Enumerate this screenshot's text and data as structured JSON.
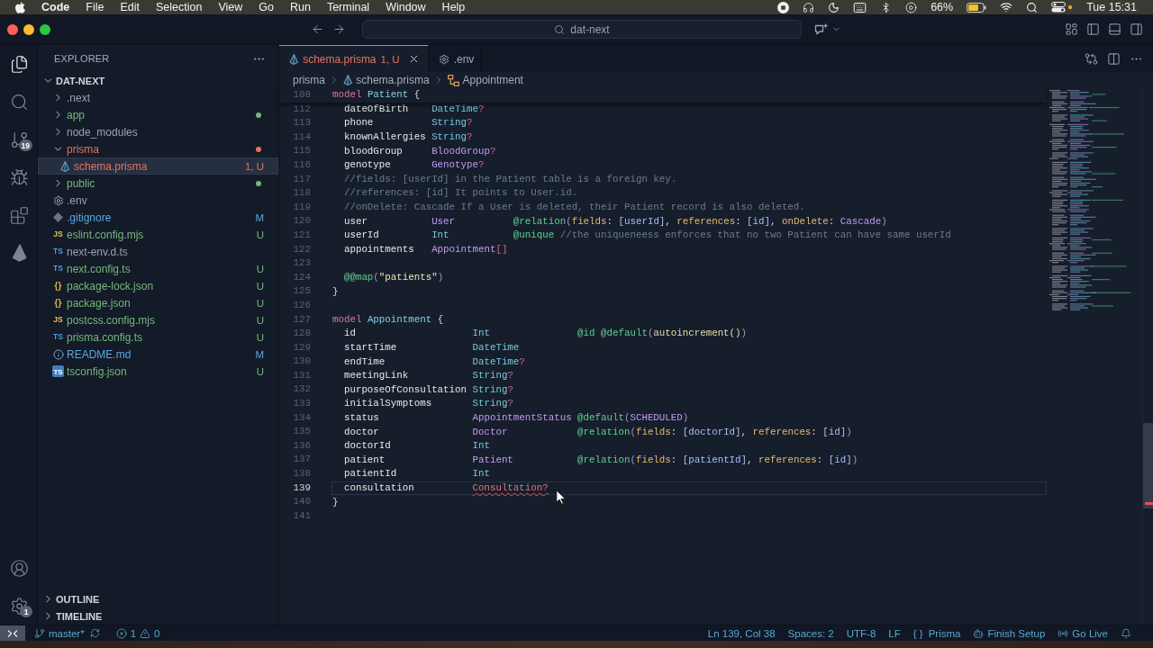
{
  "menu_bar": {
    "app": "Code",
    "menus": [
      "File",
      "Edit",
      "Selection",
      "View",
      "Go",
      "Run",
      "Terminal",
      "Window",
      "Help"
    ],
    "battery": "66%",
    "clock": "Tue 15:31"
  },
  "title_bar": {
    "search": "dat-next"
  },
  "activity_bar": {
    "items": [
      {
        "kind": "files",
        "selected": true
      },
      {
        "kind": "search",
        "selected": false
      },
      {
        "kind": "source-control",
        "selected": false,
        "badge": "19"
      },
      {
        "kind": "run",
        "selected": false
      },
      {
        "kind": "extensions",
        "selected": false
      },
      {
        "kind": "prisma",
        "selected": false
      }
    ],
    "bottom": [
      {
        "kind": "accounts"
      },
      {
        "kind": "settings",
        "badge": "1"
      }
    ]
  },
  "explorer": {
    "title": "EXPLORER",
    "root": {
      "label": "DAT-NEXT",
      "expanded": true
    },
    "items": [
      {
        "name": ".next",
        "kind": "folder",
        "expanded": false,
        "color": "#9aa2af",
        "selected": false
      },
      {
        "name": "app",
        "kind": "folder",
        "expanded": false,
        "color": "#74b87a",
        "dot": true,
        "selected": false
      },
      {
        "name": "node_modules",
        "kind": "folder",
        "expanded": false,
        "color": "#9aa2af",
        "selected": false
      },
      {
        "name": "prisma",
        "kind": "folder",
        "expanded": true,
        "color": "#e3735f",
        "dot": true,
        "selected": false,
        "children": [
          {
            "name": "schema.prisma",
            "kind": "prisma",
            "color": "#e3735f",
            "decoration": "1, U",
            "selected": true
          }
        ]
      },
      {
        "name": "public",
        "kind": "folder",
        "expanded": false,
        "color": "#74b87a",
        "dot": true,
        "selected": false
      },
      {
        "name": ".env",
        "kind": "env",
        "color": "#9aa2af",
        "selected": false
      },
      {
        "name": ".gitignore",
        "kind": "git",
        "color": "#5aa7dc",
        "decoration": "M",
        "selected": false
      },
      {
        "name": "eslint.config.mjs",
        "kind": "js",
        "badge": "JS",
        "color": "#74b87a",
        "decoration": "U",
        "selected": false
      },
      {
        "name": "next-env.d.ts",
        "kind": "ts",
        "badge": "TS",
        "color": "#9aa2af",
        "selected": false
      },
      {
        "name": "next.config.ts",
        "kind": "ts",
        "badge": "TS",
        "color": "#74b87a",
        "decoration": "U",
        "selected": false
      },
      {
        "name": "package-lock.json",
        "kind": "json",
        "badge": "{}",
        "color": "#74b87a",
        "decoration": "U",
        "selected": false
      },
      {
        "name": "package.json",
        "kind": "json",
        "badge": "{}",
        "color": "#74b87a",
        "decoration": "U",
        "selected": false
      },
      {
        "name": "postcss.config.mjs",
        "kind": "js",
        "badge": "JS",
        "color": "#74b87a",
        "decoration": "U",
        "selected": false
      },
      {
        "name": "prisma.config.ts",
        "kind": "ts",
        "badge": "TS",
        "color": "#74b87a",
        "decoration": "U",
        "selected": false
      },
      {
        "name": "README.md",
        "kind": "markdown",
        "color": "#5aa7dc",
        "decoration": "M",
        "selected": false
      },
      {
        "name": "tsconfig.json",
        "kind": "tsconfig",
        "badge": "TS",
        "color": "#74b87a",
        "decoration": "U",
        "selected": false
      }
    ],
    "sections": [
      {
        "label": "OUTLINE",
        "expanded": false
      },
      {
        "label": "TIMELINE",
        "expanded": false
      }
    ]
  },
  "tabs": [
    {
      "label": "schema.prisma",
      "kind": "prisma",
      "color": "#e3735f",
      "decoration": "1, U",
      "selected": true
    },
    {
      "label": ".env",
      "kind": "env",
      "color": "#a0a8b5",
      "selected": false
    }
  ],
  "breadcrumbs": [
    {
      "label": "prisma",
      "kind": "folder"
    },
    {
      "label": "schema.prisma",
      "kind": "prisma"
    },
    {
      "label": "Appointment",
      "kind": "model"
    }
  ],
  "editor": {
    "sticky_line": {
      "number": "108",
      "keyword": "model",
      "name": "Patient",
      "brace": "{"
    },
    "lines": [
      {
        "number": "112",
        "kind": "field",
        "current": false,
        "name": "dateOfBirth",
        "type": {
          "kind": "scalar",
          "name": "DateTime",
          "modifier": "?"
        }
      },
      {
        "number": "113",
        "kind": "field",
        "current": false,
        "name": "phone",
        "type": {
          "kind": "scalar",
          "name": "String",
          "modifier": "?"
        }
      },
      {
        "number": "114",
        "kind": "field",
        "current": false,
        "name": "knownAllergies",
        "type": {
          "kind": "scalar",
          "name": "String",
          "modifier": "?"
        }
      },
      {
        "number": "115",
        "kind": "field",
        "current": false,
        "name": "bloodGroup",
        "type": {
          "kind": "ref",
          "name": "BloodGroup",
          "modifier": "?"
        }
      },
      {
        "number": "116",
        "kind": "field",
        "current": false,
        "name": "genotype",
        "type": {
          "kind": "ref",
          "name": "Genotype",
          "modifier": "?"
        }
      },
      {
        "number": "117",
        "kind": "comment",
        "current": false,
        "text": "//fields: [userId] in the Patient table is a foreign key."
      },
      {
        "number": "118",
        "kind": "comment",
        "current": false,
        "text": "//references: [id] It points to User.id."
      },
      {
        "number": "119",
        "kind": "comment",
        "current": false,
        "text": "//onDelete: Cascade If a User is deleted, their Patient record is also deleted."
      },
      {
        "number": "120",
        "kind": "field",
        "current": false,
        "name": "user",
        "type": {
          "kind": "ref",
          "name": "User"
        },
        "attributes": [
          {
            "tokens": [
              {
                "kind": "attr",
                "text": "@relation"
              },
              {
                "kind": "paren",
                "text": "("
              },
              {
                "kind": "arg",
                "text": "fields"
              },
              {
                "kind": "plain",
                "text": ": "
              },
              {
                "kind": "list",
                "text": "[userId]"
              },
              {
                "kind": "plain",
                "text": ", "
              },
              {
                "kind": "arg",
                "text": "references"
              },
              {
                "kind": "plain",
                "text": ": "
              },
              {
                "kind": "list",
                "text": "[id]"
              },
              {
                "kind": "plain",
                "text": ", "
              },
              {
                "kind": "arg",
                "text": "onDelete"
              },
              {
                "kind": "plain",
                "text": ": "
              },
              {
                "kind": "const",
                "text": "Cascade"
              },
              {
                "kind": "paren",
                "text": ")"
              }
            ]
          }
        ]
      },
      {
        "number": "121",
        "kind": "field",
        "current": false,
        "name": "userId",
        "type": {
          "kind": "scalar",
          "name": "Int"
        },
        "attributes": [
          {
            "tokens": [
              {
                "kind": "attr",
                "text": "@unique"
              }
            ]
          }
        ],
        "comment": "//the uniqueneess enforces that no two Patient can have same userId"
      },
      {
        "number": "122",
        "kind": "field",
        "current": false,
        "name": "appointments",
        "type": {
          "kind": "ref",
          "name": "Appointment",
          "modifier": "[]"
        }
      },
      {
        "number": "123",
        "kind": "blank",
        "current": false
      },
      {
        "number": "124",
        "kind": "block_attribute",
        "current": false,
        "tokens": [
          {
            "kind": "attr",
            "text": "@@map"
          },
          {
            "kind": "paren",
            "text": "("
          },
          {
            "kind": "string",
            "text": "\"patients\""
          },
          {
            "kind": "paren",
            "text": ")"
          }
        ]
      },
      {
        "number": "125",
        "kind": "close",
        "current": false,
        "text": "}"
      },
      {
        "number": "126",
        "kind": "blank",
        "current": false
      },
      {
        "number": "127",
        "kind": "model",
        "current": false,
        "keyword": "model",
        "name": "Appointment",
        "brace": "{"
      },
      {
        "number": "128",
        "kind": "field",
        "current": false,
        "name": "id",
        "type": {
          "kind": "scalar",
          "name": "Int"
        },
        "attributes": [
          {
            "tokens": [
              {
                "kind": "attr",
                "text": "@id"
              }
            ]
          },
          {
            "tokens": [
              {
                "kind": "attr",
                "text": "@default"
              },
              {
                "kind": "paren",
                "text": "("
              },
              {
                "kind": "func",
                "text": "autoincrement()"
              },
              {
                "kind": "paren",
                "text": ")"
              }
            ]
          }
        ]
      },
      {
        "number": "129",
        "kind": "field",
        "current": false,
        "name": "startTime",
        "type": {
          "kind": "scalar",
          "name": "DateTime"
        }
      },
      {
        "number": "130",
        "kind": "field",
        "current": false,
        "name": "endTime",
        "type": {
          "kind": "scalar",
          "name": "DateTime",
          "modifier": "?"
        }
      },
      {
        "number": "131",
        "kind": "field",
        "current": false,
        "name": "meetingLink",
        "type": {
          "kind": "scalar",
          "name": "String",
          "modifier": "?"
        }
      },
      {
        "number": "132",
        "kind": "field",
        "current": false,
        "name": "purposeOfConsultation",
        "type": {
          "kind": "scalar",
          "name": "String",
          "modifier": "?"
        }
      },
      {
        "number": "133",
        "kind": "field",
        "current": false,
        "name": "initialSymptoms",
        "type": {
          "kind": "scalar",
          "name": "String",
          "modifier": "?"
        }
      },
      {
        "number": "134",
        "kind": "field",
        "current": false,
        "name": "status",
        "type": {
          "kind": "ref",
          "name": "AppointmentStatus"
        },
        "attributes": [
          {
            "tokens": [
              {
                "kind": "attr",
                "text": "@default"
              },
              {
                "kind": "paren",
                "text": "("
              },
              {
                "kind": "const",
                "text": "SCHEDULED"
              },
              {
                "kind": "paren",
                "text": ")"
              }
            ]
          }
        ]
      },
      {
        "number": "135",
        "kind": "field",
        "current": false,
        "name": "doctor",
        "type": {
          "kind": "ref",
          "name": "Doctor"
        },
        "attributes": [
          {
            "tokens": [
              {
                "kind": "attr",
                "text": "@relation"
              },
              {
                "kind": "paren",
                "text": "("
              },
              {
                "kind": "arg",
                "text": "fields"
              },
              {
                "kind": "plain",
                "text": ": "
              },
              {
                "kind": "list",
                "text": "[doctorId]"
              },
              {
                "kind": "plain",
                "text": ", "
              },
              {
                "kind": "arg",
                "text": "references"
              },
              {
                "kind": "plain",
                "text": ": "
              },
              {
                "kind": "list",
                "text": "[id]"
              },
              {
                "kind": "paren",
                "text": ")"
              }
            ]
          }
        ]
      },
      {
        "number": "136",
        "kind": "field",
        "current": false,
        "name": "doctorId",
        "type": {
          "kind": "scalar",
          "name": "Int"
        }
      },
      {
        "number": "137",
        "kind": "field",
        "current": false,
        "name": "patient",
        "type": {
          "kind": "ref",
          "name": "Patient"
        },
        "attributes": [
          {
            "tokens": [
              {
                "kind": "attr",
                "text": "@relation"
              },
              {
                "kind": "paren",
                "text": "("
              },
              {
                "kind": "arg",
                "text": "fields"
              },
              {
                "kind": "plain",
                "text": ": "
              },
              {
                "kind": "list",
                "text": "[patientId]"
              },
              {
                "kind": "plain",
                "text": ", "
              },
              {
                "kind": "arg",
                "text": "references"
              },
              {
                "kind": "plain",
                "text": ": "
              },
              {
                "kind": "list",
                "text": "[id]"
              },
              {
                "kind": "paren",
                "text": ")"
              }
            ]
          }
        ]
      },
      {
        "number": "138",
        "kind": "field",
        "current": false,
        "name": "patientId",
        "type": {
          "kind": "scalar",
          "name": "Int"
        }
      },
      {
        "number": "139",
        "kind": "field",
        "current": true,
        "name": "consultation",
        "type": {
          "kind": "ref",
          "name": "Consultation",
          "modifier": "?",
          "error": true
        }
      },
      {
        "number": "140",
        "kind": "close",
        "current": false,
        "text": "}"
      },
      {
        "number": "141",
        "kind": "blank",
        "current": false
      }
    ]
  },
  "status_bar": {
    "branch": "master*",
    "errors": "1",
    "warnings": "0",
    "items": [
      {
        "kind": "position",
        "label": "Ln 139, Col 38"
      },
      {
        "kind": "indent",
        "label": "Spaces: 2"
      },
      {
        "kind": "encoding",
        "label": "UTF-8"
      },
      {
        "kind": "eol",
        "label": "LF"
      },
      {
        "kind": "language",
        "glyph": "{ }",
        "label": "Prisma"
      },
      {
        "kind": "setup",
        "label": "Finish Setup"
      },
      {
        "kind": "live",
        "label": "Go Live"
      }
    ]
  }
}
